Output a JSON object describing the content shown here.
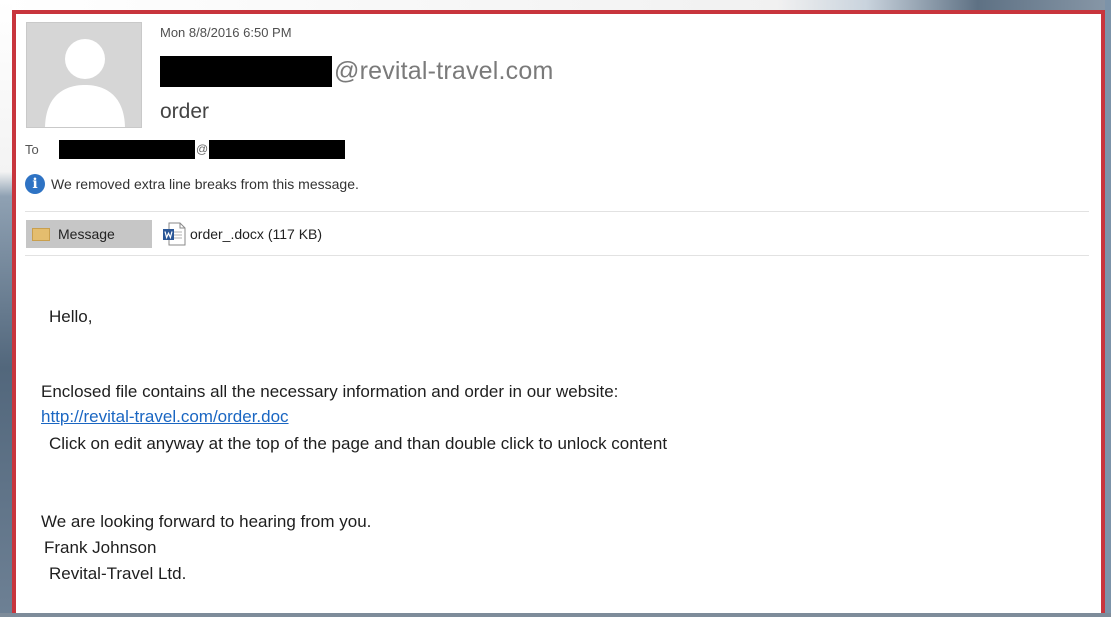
{
  "email": {
    "date": "Mon 8/8/2016 6:50 PM",
    "sender_domain": "@revital-travel.com",
    "subject": "order",
    "to_label": "To",
    "to_at": "@",
    "info_message": "We removed extra line breaks from this message.",
    "message_tab_label": "Message",
    "attachment_name": "order_.docx (117 KB)"
  },
  "body": {
    "greeting": "Hello,",
    "line_enclosed": "Enclosed file contains all the necessary information and order in our website:",
    "link": "http://revital-travel.com/order.doc",
    "line_click": "Click on edit anyway at the top of the page and than double click  to unlock content",
    "line_looking": "We are looking forward to hearing from you.",
    "signature_name": "Frank Johnson",
    "signature_company": "Revital-Travel Ltd."
  },
  "icons": {
    "avatar": "person-silhouette-icon",
    "info": "info-icon",
    "message": "envelope-icon",
    "attachment": "word-doc-icon"
  },
  "colors": {
    "window_border": "#c8353d",
    "link": "#1a66c2",
    "info_icon": "#2e73c4",
    "redaction": "#000000"
  }
}
